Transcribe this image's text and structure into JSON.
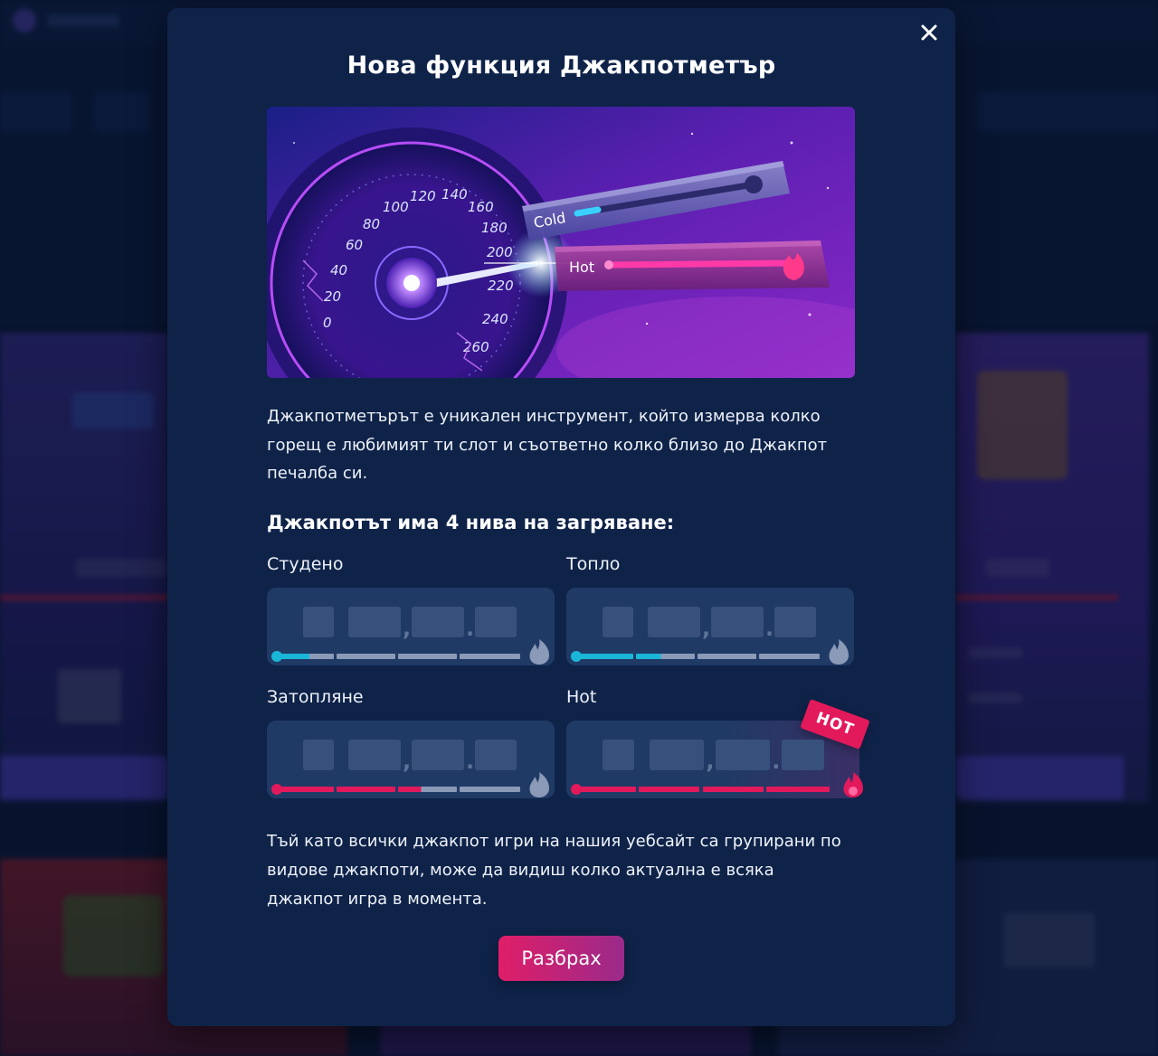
{
  "modal": {
    "title": "Нова функция Джакпотметър",
    "hero": {
      "dial_numbers": [
        "0",
        "20",
        "40",
        "60",
        "80",
        "100",
        "120",
        "140",
        "160",
        "180",
        "200",
        "220",
        "240",
        "260"
      ],
      "cold_label": "Cold",
      "hot_label": "Hot"
    },
    "intro": "Джакпотметърът е уникален инструмент, който измерва колко горещ е любимият ти слот и съответно колко близо до Джакпот печалба си.",
    "levels_heading": "Джакпотът има 4 нива на загряване:",
    "levels": [
      {
        "label": "Студено",
        "fill_fraction": 0.15,
        "accent": "#19b6d8",
        "badge": ""
      },
      {
        "label": "Топло",
        "fill_fraction": 0.36,
        "accent": "#19b6d8",
        "badge": ""
      },
      {
        "label": "Затопляне",
        "fill_fraction": 0.6,
        "accent": "#e2195b",
        "badge": ""
      },
      {
        "label": "Hot",
        "fill_fraction": 1.0,
        "accent": "#e2195b",
        "badge": "HOT"
      }
    ],
    "outro": "Тъй като всички джакпот игри на нашия уебсайт са групирани по видове джакпоти, може да видиш колко актуална е всяка джакпот игра в момента.",
    "confirm_button": "Разбрах",
    "close_icon": "close-icon"
  },
  "colors": {
    "modal_bg": "#0f2349",
    "cold": "#19b6d8",
    "hot": "#e2195b",
    "meter_bg": "#203a66"
  }
}
